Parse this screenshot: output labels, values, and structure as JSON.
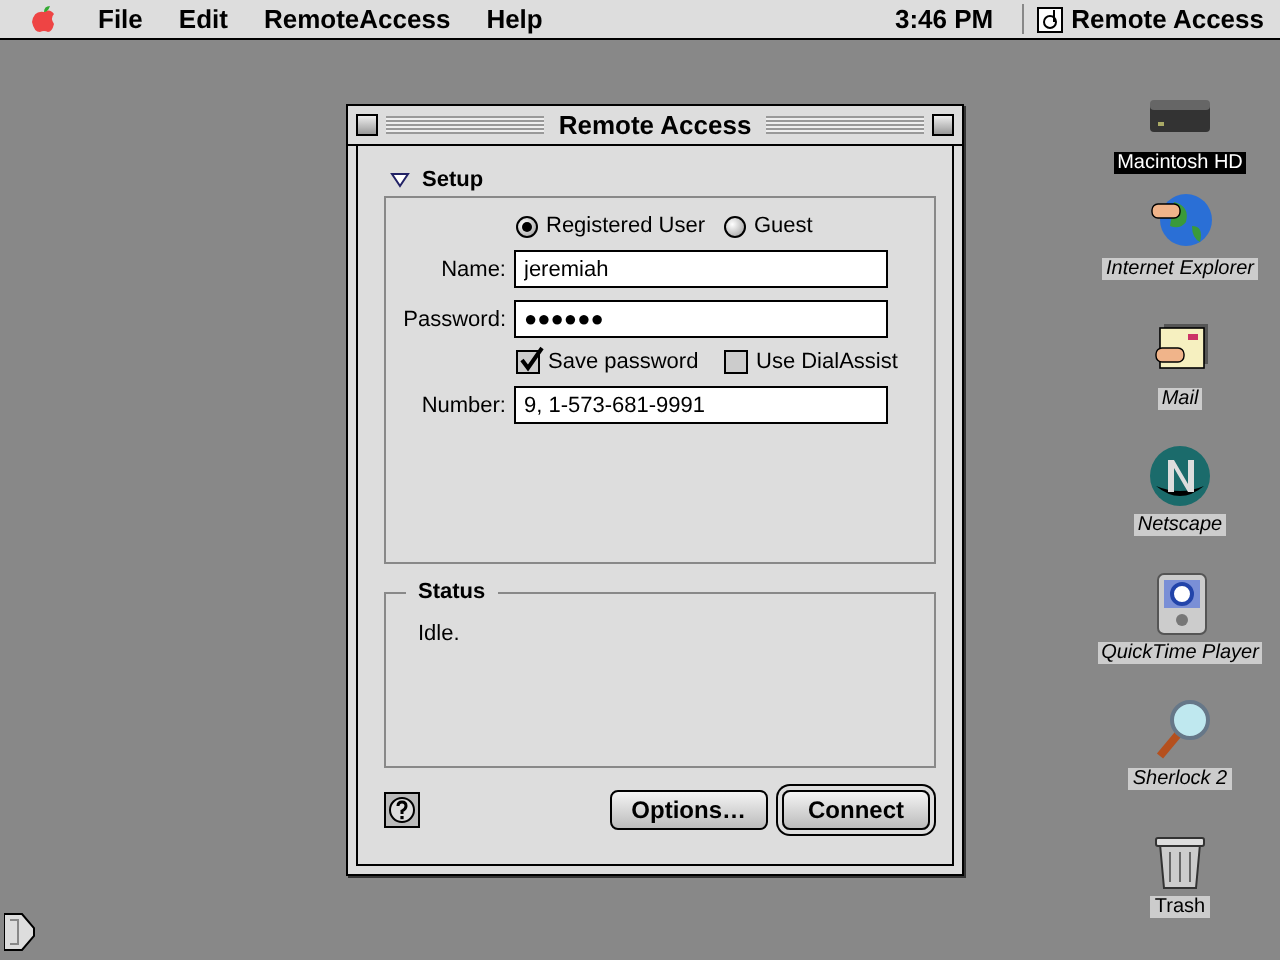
{
  "menu_bar": {
    "items": [
      "File",
      "Edit",
      "RemoteAccess",
      "Help"
    ],
    "clock": "3:46 PM",
    "app": "Remote Access"
  },
  "window": {
    "title": "Remote Access",
    "setup": {
      "label": "Setup",
      "expanded": true,
      "account_type": [
        {
          "label": "Registered User",
          "selected": true
        },
        {
          "label": "Guest",
          "selected": false
        }
      ],
      "name": {
        "label": "Name:",
        "value": "jeremiah"
      },
      "password": {
        "label": "Password:",
        "value": "●●●●●●"
      },
      "options": [
        {
          "label": "Save password",
          "checked": true
        },
        {
          "label": "Use DialAssist",
          "checked": false
        }
      ],
      "number": {
        "label": "Number:",
        "value": "9, 1-573-681-9991"
      }
    },
    "status": {
      "label": "Status",
      "text": "Idle."
    },
    "buttons": [
      {
        "label": "Options…",
        "default": false
      },
      {
        "label": "Connect",
        "default": true
      }
    ]
  },
  "desktop_icons": [
    {
      "label": "Macintosh HD",
      "kind": "disk",
      "selected": true,
      "alias": false
    },
    {
      "label": "Internet Explorer",
      "kind": "globe",
      "selected": false,
      "alias": true
    },
    {
      "label": "Mail",
      "kind": "mail",
      "selected": false,
      "alias": true
    },
    {
      "label": "Netscape",
      "kind": "netscape",
      "selected": false,
      "alias": true
    },
    {
      "label": "QuickTime Player",
      "kind": "quicktime",
      "selected": false,
      "alias": true
    },
    {
      "label": "Sherlock 2",
      "kind": "magnifier",
      "selected": false,
      "alias": true
    },
    {
      "label": "Trash",
      "kind": "trash",
      "selected": false,
      "alias": false
    }
  ]
}
